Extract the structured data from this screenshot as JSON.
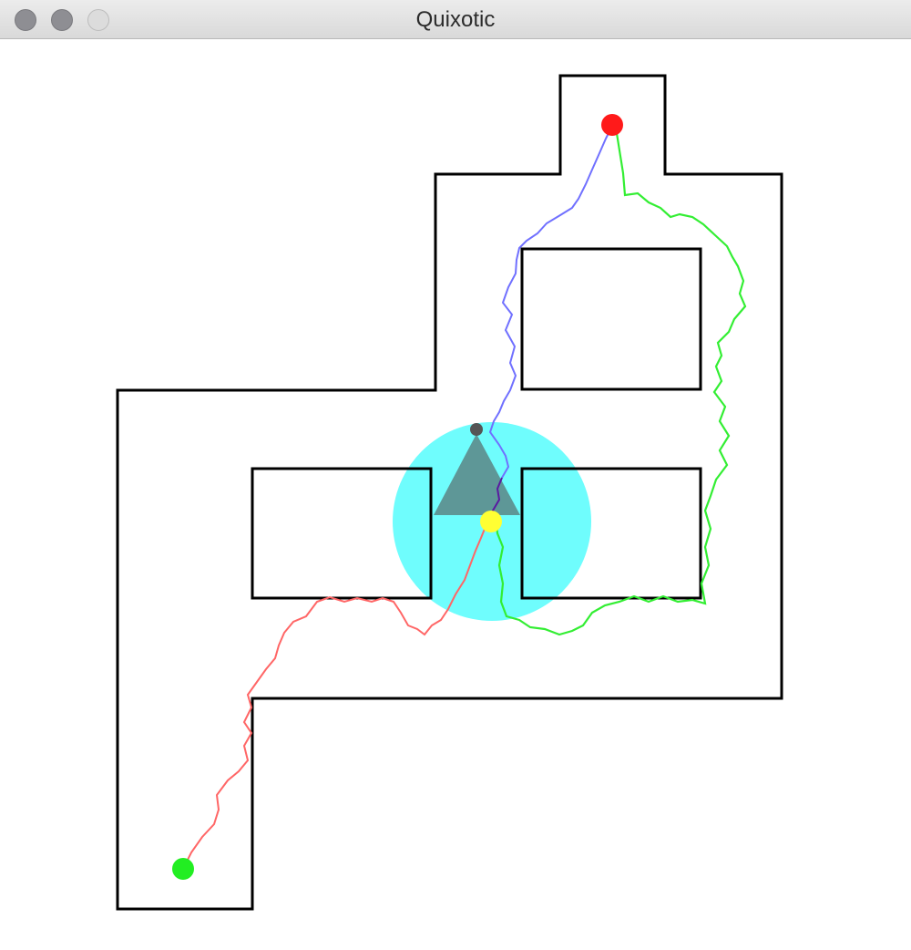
{
  "window": {
    "title": "Quixotic"
  },
  "colors": {
    "walls": "#000000",
    "sensor_range": "#6ffdfd",
    "robot_body": "#5e9797",
    "robot_sensor_tip": "#555555",
    "robot_position": "#ffff33",
    "goal": "#ff1a1a",
    "start": "#22ee22",
    "path_planned": "#7070ff",
    "path_traveled": "#ff6666",
    "path_alternate": "#33ee33",
    "path_local": "#5a1aa0"
  },
  "icons": {
    "close": "close-traffic-light-icon",
    "minimize": "minimize-traffic-light-icon",
    "zoom": "zoom-traffic-light-icon"
  }
}
